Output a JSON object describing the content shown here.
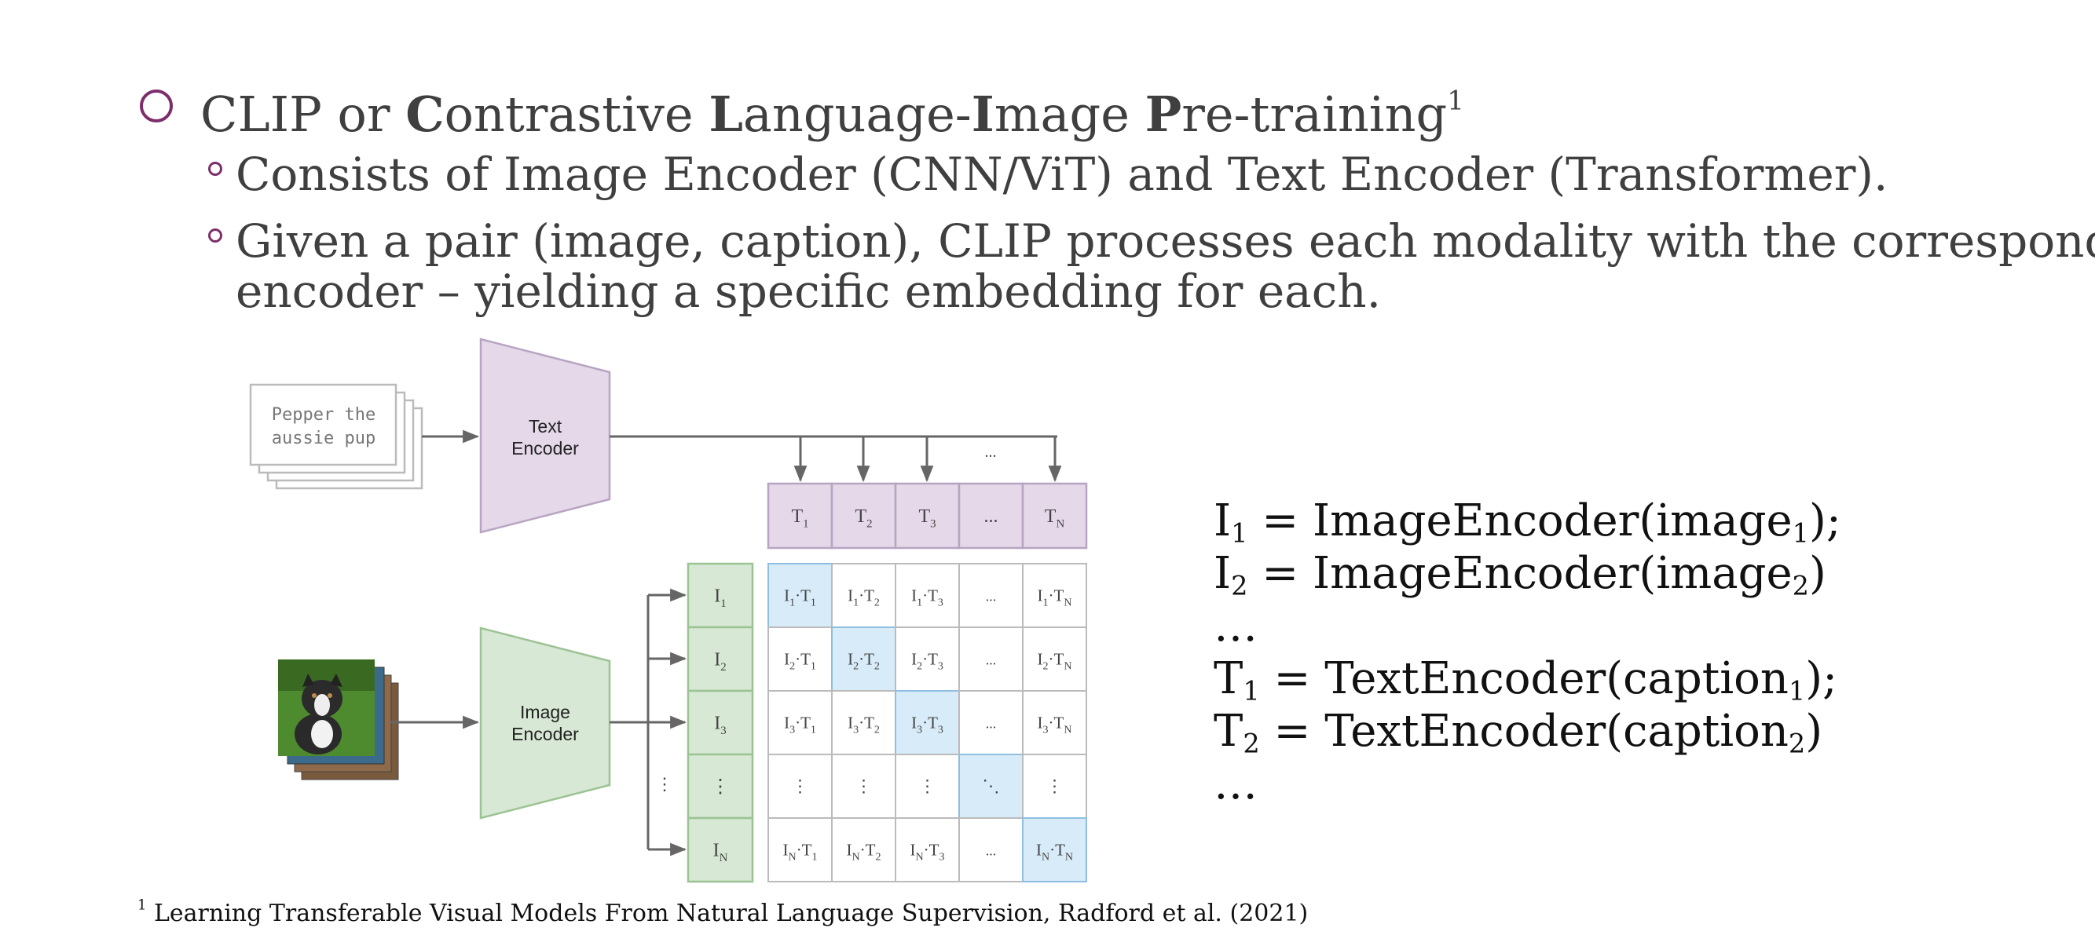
{
  "bullets": {
    "main": {
      "pre": "CLIP or ",
      "c1": "C",
      "t1": "ontrastive ",
      "c2": "L",
      "t2": "anguage-",
      "c3": "I",
      "t3": "mage ",
      "c4": "P",
      "t4": "re-training",
      "sup": "1"
    },
    "sub1": "Consists of Image Encoder (CNN/ViT) and Text Encoder (Transformer).",
    "sub2_line1": "Given a pair (image, caption), CLIP processes each modality with the corresponding",
    "sub2_line2": "encoder – yielding a specific embedding for each."
  },
  "diagram": {
    "caption_card": [
      "Pepper the",
      "aussie pup"
    ],
    "text_encoder": [
      "Text",
      "Encoder"
    ],
    "image_encoder": [
      "Image",
      "Encoder"
    ],
    "top_dots": "...",
    "text_tokens": [
      {
        "base": "T",
        "sub": "1"
      },
      {
        "base": "T",
        "sub": "2"
      },
      {
        "base": "T",
        "sub": "3"
      },
      {
        "base": "...",
        "sub": ""
      },
      {
        "base": "T",
        "sub": "N"
      }
    ],
    "image_tokens": [
      {
        "base": "I",
        "sub": "1"
      },
      {
        "base": "I",
        "sub": "2"
      },
      {
        "base": "I",
        "sub": "3"
      },
      {
        "base": "⋮",
        "sub": ""
      },
      {
        "base": "I",
        "sub": "N"
      }
    ],
    "side_dots": "⋮",
    "cell_ellipsis": "...",
    "vdots": "⋮",
    "ddots": "⋱",
    "highlight_color": "#d7ebf8",
    "text_color": "#e4d8e9",
    "image_color": "#d7e8d4"
  },
  "equations": [
    {
      "lhs": "I",
      "lsub": "1",
      "mid": " = ImageEncoder(image",
      "rsub": "1",
      "tail": ");"
    },
    {
      "lhs": "I",
      "lsub": "2",
      "mid": " = ImageEncoder(image",
      "rsub": "2",
      "tail": ")"
    },
    {
      "lhs": "…",
      "lsub": "",
      "mid": "",
      "rsub": "",
      "tail": ""
    },
    {
      "lhs": "T",
      "lsub": "1",
      "mid": " = TextEncoder(caption",
      "rsub": "1",
      "tail": ");"
    },
    {
      "lhs": "T",
      "lsub": "2",
      "mid": " = TextEncoder(caption",
      "rsub": "2",
      "tail": ")"
    },
    {
      "lhs": "…",
      "lsub": "",
      "mid": "",
      "rsub": "",
      "tail": ""
    }
  ],
  "footnote": {
    "sup": "1",
    "text": " Learning Transferable Visual Models From Natural Language Supervision, Radford et al. (2021)"
  }
}
